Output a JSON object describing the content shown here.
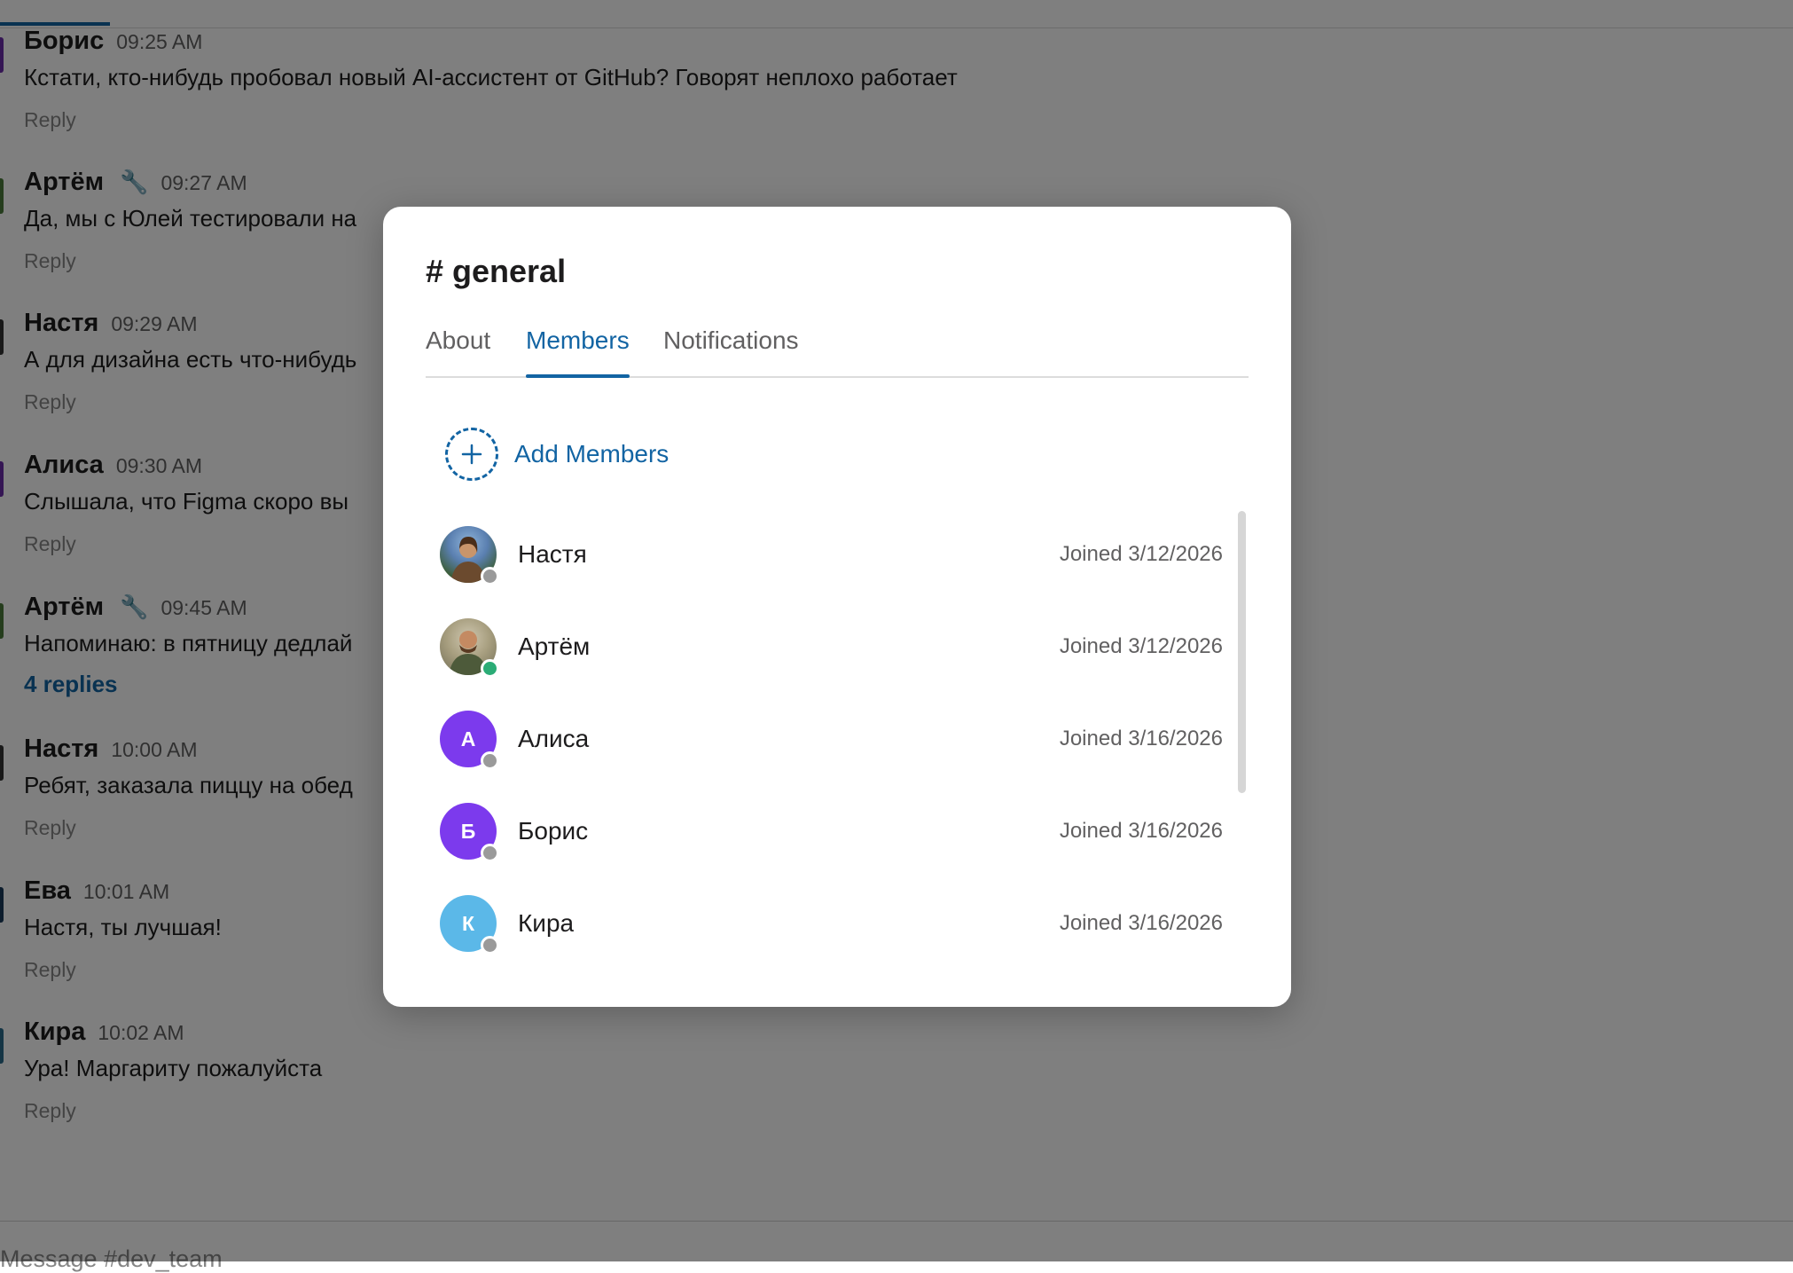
{
  "composer": {
    "placeholder": "Message #dev_team"
  },
  "messages": [
    {
      "author": "Борис",
      "badge": "",
      "time": "09:25 AM",
      "text": "Кстати, кто-нибудь пробовал новый AI-ассистент от GitHub? Говорят неплохо работает",
      "reply": "Reply",
      "edge_color": "#6a2ca8"
    },
    {
      "author": "Артём",
      "badge": "🔧",
      "time": "09:27 AM",
      "text": "Да, мы с Юлей тестировали на",
      "reply": "Reply",
      "edge_color": "#4a7a3a"
    },
    {
      "author": "Настя",
      "badge": "",
      "time": "09:29 AM",
      "text": "А для дизайна есть что-нибудь",
      "reply": "Reply",
      "edge_color": "#333333"
    },
    {
      "author": "Алиса",
      "badge": "",
      "time": "09:30 AM",
      "text": "Слышала, что Figma скоро вы",
      "reply": "Reply",
      "edge_color": "#6a2ca8"
    },
    {
      "author": "Артём",
      "badge": "🔧",
      "time": "09:45 AM",
      "text": "Напоминаю: в пятницу дедлай",
      "reply": "4 replies",
      "edge_color": "#4a7a3a"
    },
    {
      "author": "Настя",
      "badge": "",
      "time": "10:00 AM",
      "text": "Ребят, заказала пиццу на обед",
      "reply": "Reply",
      "edge_color": "#333333"
    },
    {
      "author": "Ева",
      "badge": "",
      "time": "10:01 AM",
      "text": "Настя, ты лучшая!",
      "reply": "Reply",
      "edge_color": "#1a3a5a"
    },
    {
      "author": "Кира",
      "badge": "",
      "time": "10:02 AM",
      "text": "Ура! Маргариту пожалуйста",
      "reply": "Reply",
      "edge_color": "#2a6a8a"
    }
  ],
  "modal": {
    "title": "# general",
    "tabs": [
      {
        "label": "About",
        "active": false
      },
      {
        "label": "Members",
        "active": true
      },
      {
        "label": "Notifications",
        "active": false
      }
    ],
    "add_members_label": "Add Members",
    "members": [
      {
        "name": "Настя",
        "joined": "Joined 3/12/2026",
        "initial": "",
        "avatar_type": "photo",
        "avatar_color": "#5a7fb0",
        "presence": "away"
      },
      {
        "name": "Артём",
        "joined": "Joined 3/12/2026",
        "initial": "",
        "avatar_type": "photo",
        "avatar_color": "#8a7f5a",
        "presence": "online"
      },
      {
        "name": "Алиса",
        "joined": "Joined 3/16/2026",
        "initial": "А",
        "avatar_type": "initial",
        "avatar_color": "#7c3aed",
        "presence": "away"
      },
      {
        "name": "Борис",
        "joined": "Joined 3/16/2026",
        "initial": "Б",
        "avatar_type": "initial",
        "avatar_color": "#7c3aed",
        "presence": "away"
      },
      {
        "name": "Кира",
        "joined": "Joined 3/16/2026",
        "initial": "К",
        "avatar_type": "initial",
        "avatar_color": "#5bb8e8",
        "presence": "away"
      }
    ]
  },
  "colors": {
    "accent": "#1264a3",
    "online": "#2bac76",
    "away": "#9a9a9a"
  }
}
